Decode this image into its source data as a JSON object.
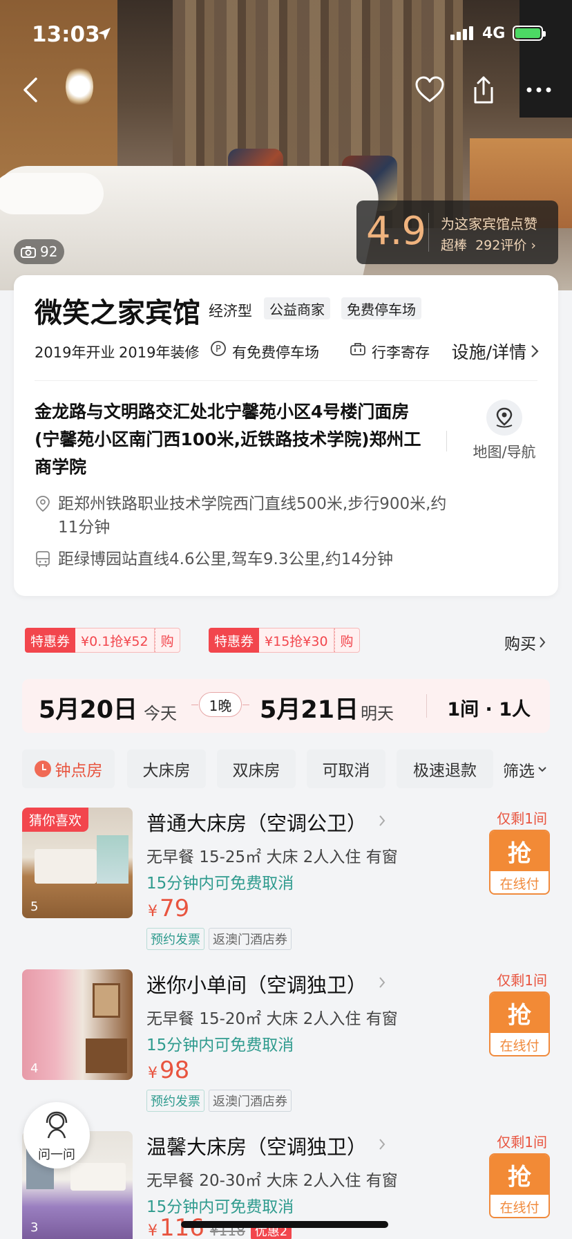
{
  "status": {
    "time": "13:03",
    "network": "4G"
  },
  "gallery": {
    "photo_count": "92"
  },
  "rating": {
    "score": "4.9",
    "prompt": "为这家宾馆点赞",
    "level": "超棒",
    "reviews": "292评价"
  },
  "hotel": {
    "name": "微笑之家宾馆",
    "type": "经济型",
    "tags": [
      "公益商家",
      "免费停车场"
    ],
    "opened": "2019年开业",
    "renovated": "2019年装修",
    "parking": "有免费停车场",
    "luggage": "行李寄存",
    "facility_link": "设施/详情",
    "address": "金龙路与文明路交汇处北宁馨苑小区4号楼门面房(宁馨苑小区南门西100米,近铁路技术学院)郑州工商学院",
    "map_label": "地图/导航",
    "distance1": "距郑州铁路职业技术学院西门直线500米,步行900米,约11分钟",
    "distance2": "距绿博园站直线4.6公里,驾车9.3公里,约14分钟"
  },
  "coupons": [
    {
      "head": "特惠券",
      "body": "¥0.1抢¥52",
      "tail": "购"
    },
    {
      "head": "特惠券",
      "body": "¥15抢¥30",
      "tail": "购"
    }
  ],
  "buy_link": "购买",
  "dates": {
    "checkin": "5月20日",
    "checkin_day": "今天",
    "nights": "1晚",
    "checkout": "5月21日",
    "checkout_day": "明天",
    "guests": "1间 · 1人"
  },
  "filters": [
    "钟点房",
    "大床房",
    "双床房",
    "可取消",
    "极速退款"
  ],
  "filter_more": "筛选",
  "rooms": [
    {
      "name": "普通大床房（空调公卫）",
      "desc": "无早餐 15-25㎡ 大床 2人入住 有窗",
      "cancel": "15分钟内可免费取消",
      "currency": "¥",
      "price": "79",
      "tags": [
        "预约发票",
        "返澳门酒店券"
      ],
      "left": "仅剩1间",
      "btn_top": "抢",
      "btn_bottom": "在线付",
      "img_count": "5",
      "badge": "猜你喜欢"
    },
    {
      "name": "迷你小单间（空调独卫）",
      "desc": "无早餐 15-20㎡ 大床 2人入住 有窗",
      "cancel": "15分钟内可免费取消",
      "currency": "¥",
      "price": "98",
      "tags": [
        "预约发票",
        "返澳门酒店券"
      ],
      "left": "仅剩1间",
      "btn_top": "抢",
      "btn_bottom": "在线付",
      "img_count": "4"
    },
    {
      "name": "温馨大床房（空调独卫）",
      "desc": "无早餐 20-30㎡ 大床 2人入住 有窗",
      "cancel": "15分钟内可免费取消",
      "currency": "¥",
      "price": "116",
      "orig_price": "¥118",
      "promo": "优惠2",
      "left": "仅剩1间",
      "btn_top": "抢",
      "btn_bottom": "在线付",
      "img_count": "3"
    }
  ],
  "ask": {
    "label": "问一问"
  }
}
